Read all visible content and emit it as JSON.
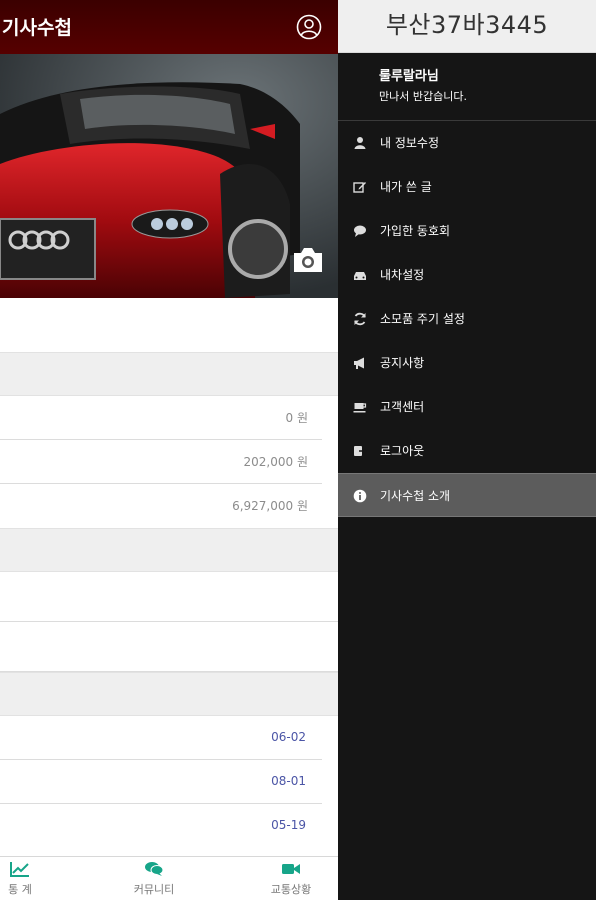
{
  "app": {
    "title": "기사수첩"
  },
  "stats": {
    "values": [
      "0 원",
      "202,000 원",
      "6,927,000 원"
    ],
    "dates": [
      "06-02",
      "08-01",
      "05-19"
    ]
  },
  "tabs": [
    {
      "label": "통 계",
      "icon": "chart-icon"
    },
    {
      "label": "커뮤니티",
      "icon": "chat-icon"
    },
    {
      "label": "교통상황",
      "icon": "video-camera-icon"
    }
  ],
  "drawer": {
    "plate": "부산37바3445",
    "user_name": "룰루랄라님",
    "greeting": "만나서 반갑습니다.",
    "menu": [
      {
        "label": "내 정보수정",
        "icon": "user-icon"
      },
      {
        "label": "내가 쓴 글",
        "icon": "edit-icon"
      },
      {
        "label": "가입한 동호회",
        "icon": "comment-icon"
      },
      {
        "label": "내차설정",
        "icon": "car-icon"
      },
      {
        "label": "소모품 주기 설정",
        "icon": "refresh-icon"
      },
      {
        "label": "공지사항",
        "icon": "megaphone-icon"
      },
      {
        "label": "고객센터",
        "icon": "coffee-icon"
      },
      {
        "label": "로그아웃",
        "icon": "logout-icon"
      },
      {
        "label": "기사수첩 소개",
        "icon": "info-icon",
        "active": true
      }
    ]
  },
  "colors": {
    "accent": "#17a589",
    "date": "#4b55a6",
    "drawer_bg": "#151515",
    "header": "#4a0000"
  }
}
